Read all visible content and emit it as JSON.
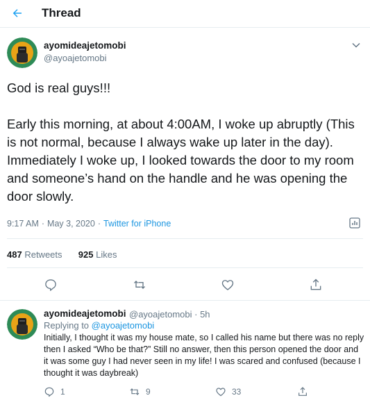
{
  "header": {
    "title": "Thread"
  },
  "tweet": {
    "name": "ayomideajetomobi",
    "handle": "@ayoajetomobi",
    "line1": "God is real guys!!!",
    "body": "Early this morning, at about 4:00AM, I woke up abruptly (This is not normal, because I always wake up later in the day). Immediately I woke up, I looked towards the door to my room and someone’s hand on the handle and he was opening the door slowly.",
    "time": "9:17 AM",
    "date": "May 3, 2020",
    "separator": "·",
    "source": "Twitter for iPhone",
    "retweets_count": "487",
    "retweets_label": "Retweets",
    "likes_count": "925",
    "likes_label": "Likes"
  },
  "reply": {
    "name": "ayomideajetomobi",
    "handle_time": "@ayoajetomobi · 5h",
    "replying_prefix": "Replying to",
    "replying_to": "@ayoajetomobi",
    "text": "Initially, I thought it was my house mate, so I called his name but there was no reply then I asked “Who be that?” Still no answer, then this person opened the door and it was some guy I had never seen in my life! I was scared and confused (because I thought it was daybreak)",
    "reply_count": "1",
    "retweet_count": "9",
    "like_count": "33"
  },
  "colors": {
    "accent": "#1da1f2",
    "text": "#14171a",
    "muted": "#657786",
    "divider": "#e6ecf0"
  },
  "icons": [
    "back-arrow-icon",
    "chevron-down-icon",
    "analytics-icon",
    "reply-icon",
    "retweet-icon",
    "like-icon",
    "share-icon"
  ]
}
